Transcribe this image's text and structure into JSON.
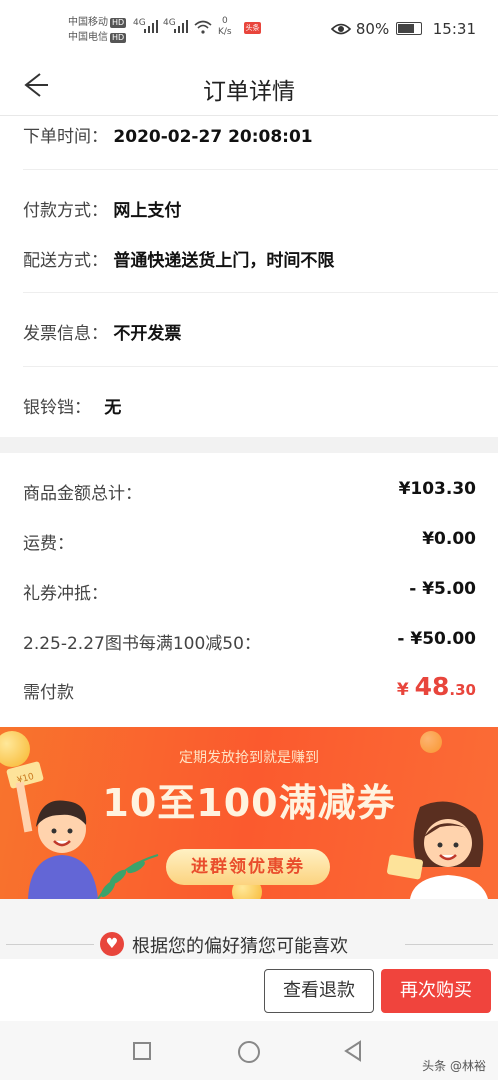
{
  "status_bar": {
    "carrier1": "中国移动",
    "carrier2": "中国电信",
    "hd": "HD",
    "signal1": "4G",
    "signal2": "4G",
    "speed_value": "0",
    "speed_unit": "K/s",
    "news_badge": "头条",
    "battery": "80%",
    "time": "15:31"
  },
  "header": {
    "title": "订单详情"
  },
  "order_info": {
    "time_label": "下单时间：",
    "time_value": "2020-02-27 20:08:01",
    "pay_label": "付款方式：",
    "pay_value": "网上支付",
    "ship_label": "配送方式：",
    "ship_value": "普通快递送货上门，时间不限",
    "invoice_label": "发票信息：",
    "invoice_value": "不开发票",
    "bell_label": "银铃铛：",
    "bell_value": "无"
  },
  "amounts": {
    "rows": [
      {
        "label": "商品金额总计：",
        "value": "¥103.30"
      },
      {
        "label": "运费：",
        "value": "¥0.00"
      },
      {
        "label": "礼券冲抵：",
        "value": "- ¥5.00"
      },
      {
        "label": "2.25-2.27图书每满100减50：",
        "value": "- ¥50.00"
      }
    ],
    "due_label": "需付款",
    "due_currency": "¥",
    "due_int": "48",
    "due_dec": ".30"
  },
  "banner": {
    "top_text": "定期发放抢到就是赚到",
    "main_text": "10至100满减券",
    "button_text": "进群领优惠券",
    "coupon_tag": "¥10"
  },
  "recommend": {
    "text": "根据您的偏好猜您可能喜欢"
  },
  "actions": {
    "view_refund": "查看退款",
    "buy_again": "再次购买"
  },
  "watermark": "头条 @林裕",
  "colors": {
    "accent_red": "#e8453c",
    "banner_orange": "#fb5a2e"
  }
}
